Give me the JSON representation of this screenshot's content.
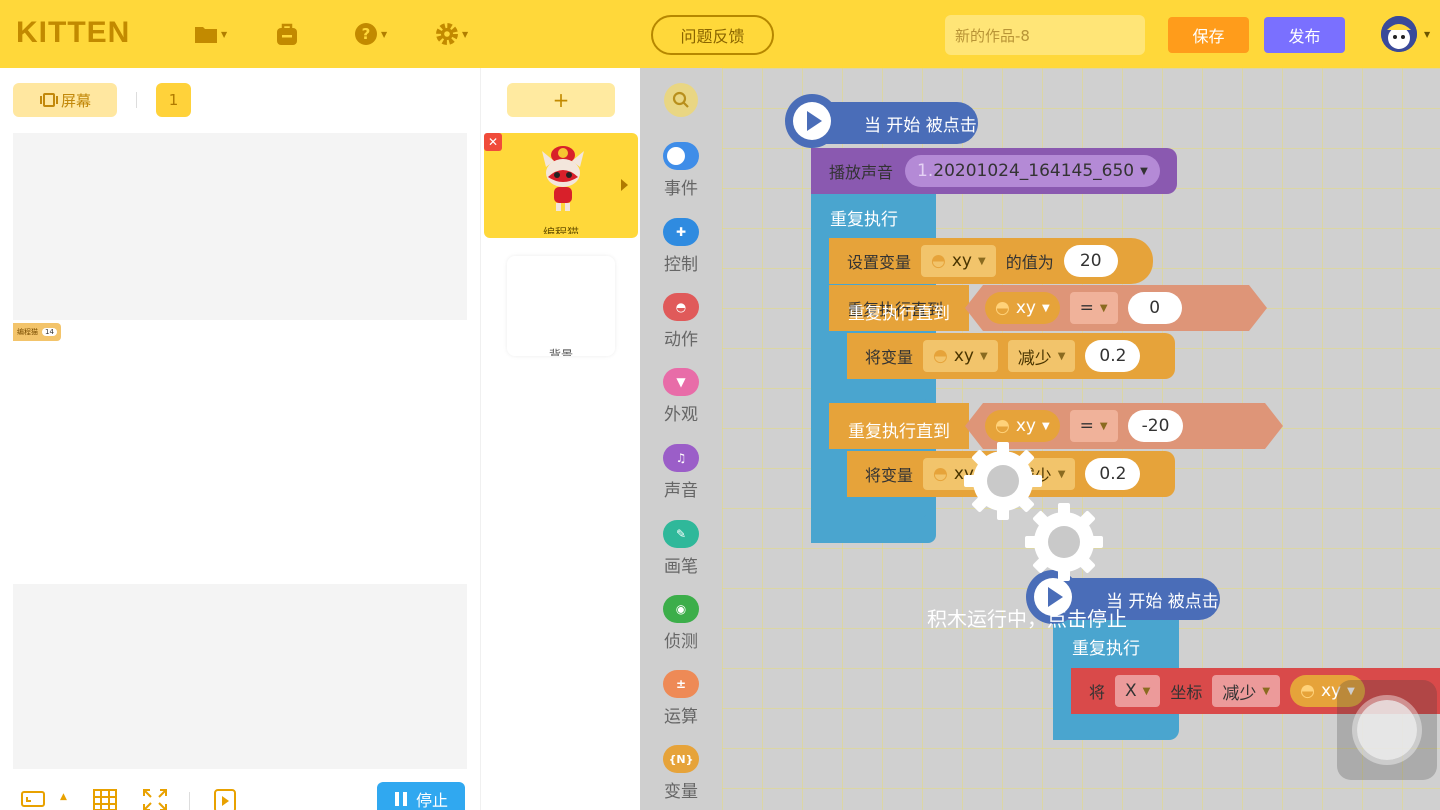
{
  "topbar": {
    "logo": "KITTEN",
    "feedback_label": "问题反馈",
    "project_name": "新的作品-8",
    "save_label": "保存",
    "publish_label": "发布",
    "icons": [
      "folder-icon",
      "backpack-icon",
      "help-icon",
      "settings-icon"
    ]
  },
  "stage_panel": {
    "screen_label": "屏幕",
    "screen_number": "1",
    "stop_label": "停止",
    "variable_monitor": {
      "name": "编程猫",
      "value": "14"
    }
  },
  "sprites": {
    "add_label": "+",
    "items": [
      {
        "name": "编程猫"
      }
    ],
    "background": {
      "name": "背景"
    }
  },
  "categories": [
    {
      "label": "事件",
      "color": "#3f8de8",
      "icon": "toggle-icon"
    },
    {
      "label": "控制",
      "color": "#2f8be0",
      "icon": "gamepad-icon"
    },
    {
      "label": "动作",
      "color": "#e05a5a",
      "icon": "ghost-icon"
    },
    {
      "label": "外观",
      "color": "#e86ca8",
      "icon": "shirt-icon"
    },
    {
      "label": "声音",
      "color": "#9b5ec8",
      "icon": "music-icon"
    },
    {
      "label": "画笔",
      "color": "#2fb89a",
      "icon": "pen-icon"
    },
    {
      "label": "侦测",
      "color": "#3cae4a",
      "icon": "eye-icon"
    },
    {
      "label": "运算",
      "color": "#ee8a56",
      "icon": "math-icon"
    },
    {
      "label": "变量",
      "color": "#e6a33a",
      "icon": "variable-icon"
    }
  ],
  "blocks": {
    "script1": {
      "hat": "当 开始 被点击",
      "play_sound": "播放声音",
      "sound_index": "1.",
      "sound_name": "20201024_164145_650",
      "repeat_forever": "重复执行",
      "set_var": "设置变量",
      "var_name": "xy",
      "set_to": "的值为",
      "set_value": "20",
      "repeat_until_1": "重复执行直到",
      "op_eq": "=",
      "cmp_value_1": "0",
      "change_var_1": "将变量",
      "change_op_1": "减少",
      "change_val_1": "0.2",
      "repeat_until_2": "重复执行直到",
      "cmp_value_2": "-20",
      "change_var_2": "将变量",
      "change_op_2": "减少",
      "change_val_2": "0.2"
    },
    "script2": {
      "hat": "当 开始 被点击",
      "repeat_forever": "重复执行",
      "set_prefix": "将",
      "axis": "X",
      "coord": "坐标",
      "op": "减少",
      "var_name": "xy"
    }
  },
  "overlay": {
    "running_text": "积木运行中，点击停止"
  }
}
